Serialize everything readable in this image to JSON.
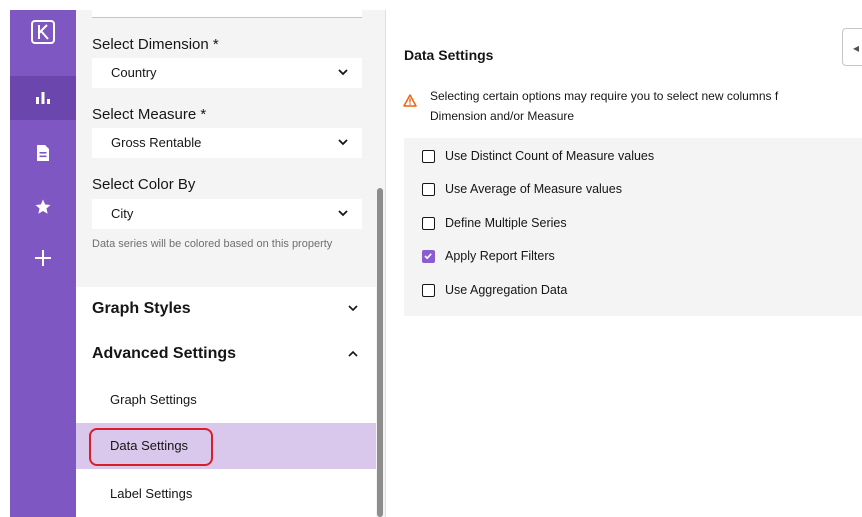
{
  "rail": {
    "icons": [
      "logo-k-icon",
      "bar-chart-icon",
      "document-icon",
      "star-icon",
      "plus-icon"
    ]
  },
  "panel": {
    "dimension": {
      "label": "Select Dimension *",
      "value": "Country"
    },
    "measure": {
      "label": "Select Measure *",
      "value": "Gross Rentable"
    },
    "color_by": {
      "label": "Select Color By",
      "value": "City",
      "helper": "Data series will be colored based on this property"
    },
    "graph_styles": "Graph Styles",
    "advanced_settings": "Advanced Settings",
    "sub_items": [
      "Graph Settings",
      "Data Settings",
      "Label Settings"
    ]
  },
  "main": {
    "title": "Data Settings",
    "warning_line1": "Selecting certain options may require you to select new columns f",
    "warning_line2": "Dimension and/or Measure",
    "options": [
      {
        "label": "Use Distinct Count of Measure values",
        "checked": false
      },
      {
        "label": "Use Average of Measure values",
        "checked": false
      },
      {
        "label": "Define Multiple Series",
        "checked": false
      },
      {
        "label": "Apply Report Filters",
        "checked": true
      },
      {
        "label": "Use Aggregation Data",
        "checked": false
      }
    ]
  },
  "colors": {
    "rail": "#7e57c2",
    "active_item": "#d9c7ec",
    "checkbox": "#8a5cd0",
    "highlight": "#da1e28",
    "warning": "#f1620c"
  }
}
